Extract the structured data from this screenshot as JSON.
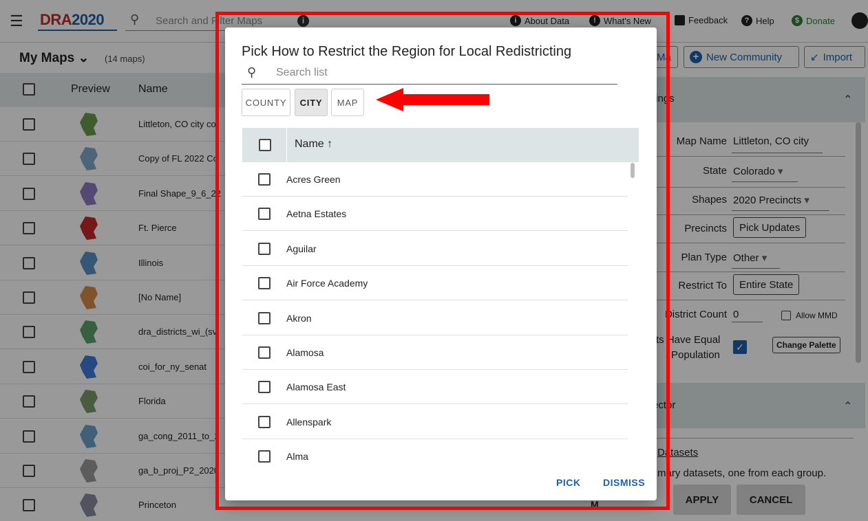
{
  "app": {
    "logo_main": "DRA",
    "logo_year": "2020",
    "search_placeholder": "Search and Filter Maps",
    "nav": {
      "about_data": "About Data",
      "whats_new": "What's New",
      "feedback": "Feedback",
      "help": "Help",
      "donate": "Donate"
    }
  },
  "toolbar": {
    "my_maps": "My Maps",
    "map_count": "(14 maps)",
    "map_btn_partial": "Ma",
    "new_community": "New Community",
    "import": "Import"
  },
  "table": {
    "col_preview": "Preview",
    "col_name": "Name",
    "rows": [
      {
        "name": "Littleton, CO city co",
        "color": "#6a9a4e"
      },
      {
        "name": "Copy of FL 2022 Co",
        "color": "#7fa8c9"
      },
      {
        "name": "Final Shape_9_6_22",
        "color": "#8a7ac2"
      },
      {
        "name": "Ft. Pierce",
        "color": "#c62828"
      },
      {
        "name": "Illinois",
        "color": "#5a8fc4"
      },
      {
        "name": "[No Name]",
        "color": "#d88a4a"
      },
      {
        "name": "dra_districts_wi_(sv",
        "color": "#5aa06a"
      },
      {
        "name": "coi_for_ny_senat",
        "color": "#3f7ad6"
      },
      {
        "name": "Florida",
        "color": "#7a9a6a"
      },
      {
        "name": "ga_cong_2011_to_2",
        "color": "#6aa0c8"
      },
      {
        "name": "ga_b_proj_P2_2020",
        "color": "#9a9a9a"
      },
      {
        "name": "Princeton",
        "color": "#8a8aa0"
      }
    ],
    "partial_cell": "M"
  },
  "settings": {
    "header_partial": "tings",
    "map_name_label": "Map Name",
    "map_name_value": "Littleton, CO city",
    "state_label": "State",
    "state_value": "Colorado",
    "shapes_label": "Shapes",
    "shapes_value": "2020 Precincts",
    "precincts_label": "Precincts",
    "precincts_btn": "Pick Updates",
    "plan_type_label": "Plan Type",
    "plan_type_value": "Other",
    "restrict_label": "Restrict To",
    "restrict_btn": "Entire State",
    "district_count_label": "District Count",
    "district_count_value": "0",
    "allow_mmd": "Allow MMD",
    "equal_pop_label_1": "ts Have Equal",
    "equal_pop_label_2": "Population",
    "change_palette": "Change Palette",
    "selector_header_partial": "ector",
    "datasets_link": "Datasets",
    "datasets_desc": "mary datasets, one from each group.",
    "apply": "APPLY",
    "cancel": "CANCEL"
  },
  "dialog": {
    "title": "Pick How to Restrict the Region for Local Redistricting",
    "search_placeholder": "Search list",
    "tabs": [
      {
        "label": "COUNTY",
        "active": false
      },
      {
        "label": "CITY",
        "active": true
      },
      {
        "label": "MAP",
        "active": false
      }
    ],
    "column_name": "Name",
    "sort_icon": "↑",
    "items": [
      "Acres Green",
      "Aetna Estates",
      "Aguilar",
      "Air Force Academy",
      "Akron",
      "Alamosa",
      "Alamosa East",
      "Allenspark",
      "Alma"
    ],
    "pick": "PICK",
    "dismiss": "DISMISS"
  },
  "colors": {
    "highlight": "#ff0000",
    "accent": "#1e5fa8",
    "header_bg": "#dde4e6"
  }
}
